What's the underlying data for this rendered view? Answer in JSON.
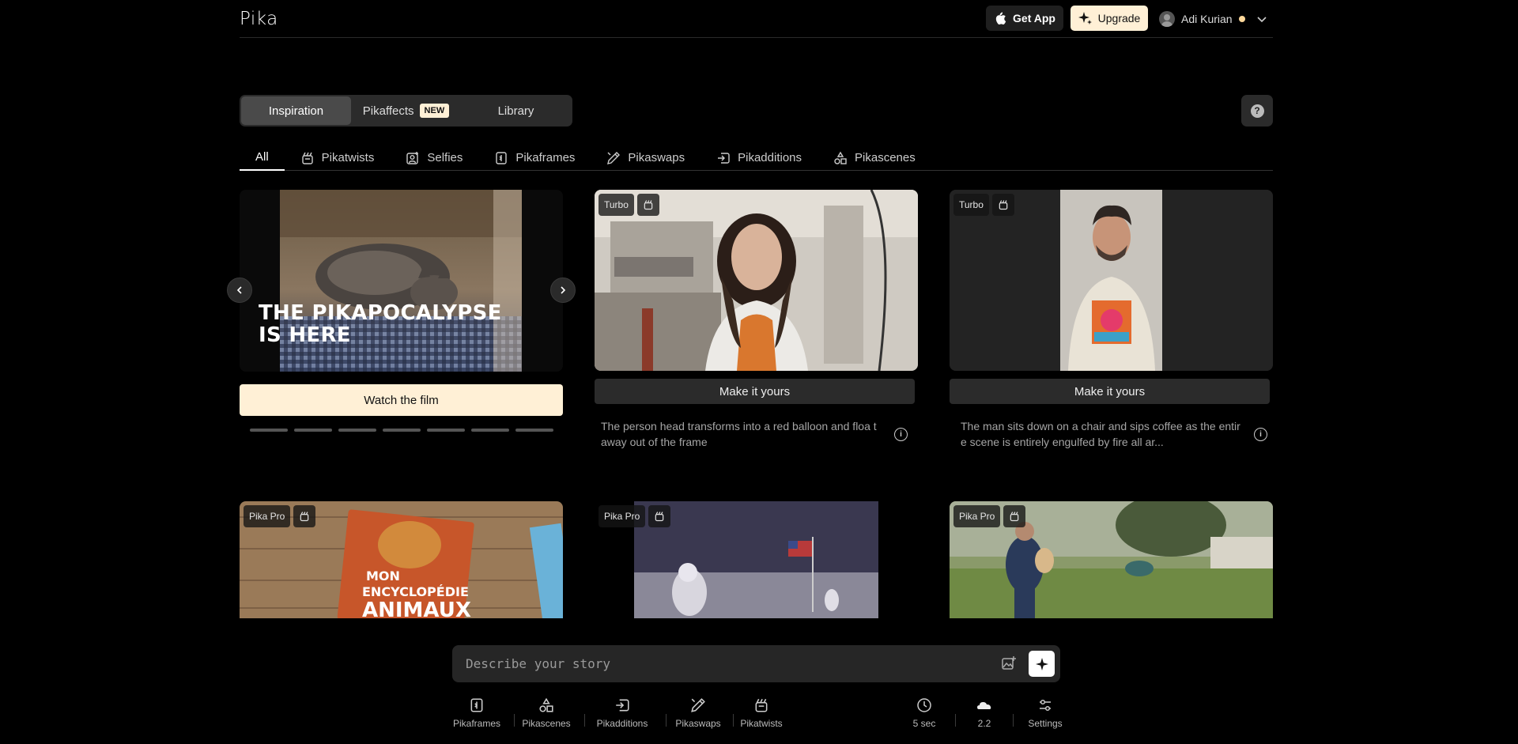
{
  "header": {
    "logo": "Pika",
    "get_app_label": "Get App",
    "upgrade_label": "Upgrade",
    "user_name": "Adi Kurian"
  },
  "top_tabs": [
    {
      "label": "Inspiration"
    },
    {
      "label": "Pikaffects",
      "badge": "NEW"
    },
    {
      "label": "Library"
    }
  ],
  "help_label": "?",
  "categories": [
    {
      "label": "All"
    },
    {
      "label": "Pikatwists"
    },
    {
      "label": "Selfies"
    },
    {
      "label": "Pikaframes"
    },
    {
      "label": "Pikaswaps"
    },
    {
      "label": "Pikadditions"
    },
    {
      "label": "Pikascenes"
    }
  ],
  "hero": {
    "headline_line1": "THE PIKAPOCALYPSE",
    "headline_line2": "IS HERE",
    "button_label": "Watch the film",
    "prev_icon": "chevron-left-icon",
    "next_icon": "chevron-right-icon"
  },
  "cards": [
    {
      "tag": "Turbo",
      "button_label": "Make it yours",
      "description": "The person head transforms into a red balloon and floa t away out of the frame"
    },
    {
      "tag": "Turbo",
      "button_label": "Make it yours",
      "description": "The man sits down on a chair and sips coffee as the entire scene is entirely engulfed by fire all ar..."
    }
  ],
  "row2_cards": [
    {
      "tag": "Pika Pro",
      "book_line1": "MON",
      "book_line2": "ENCYCLOPÉDIE",
      "book_line3": "ANIMAUX"
    },
    {
      "tag": "Pika Pro"
    },
    {
      "tag": "Pika Pro"
    }
  ],
  "composer": {
    "placeholder": "Describe your story"
  },
  "tools_left": [
    {
      "label": "Pikaframes",
      "icon": "pikaframes-icon"
    },
    {
      "label": "Pikascenes",
      "icon": "pikascenes-icon"
    },
    {
      "label": "Pikadditions",
      "icon": "pikadditions-icon"
    },
    {
      "label": "Pikaswaps",
      "icon": "pikaswaps-icon"
    },
    {
      "label": "Pikatwists",
      "icon": "pikatwists-icon"
    }
  ],
  "tools_right": [
    {
      "label": "5 sec",
      "icon": "clock-icon"
    },
    {
      "label": "2.2",
      "icon": "cloud-icon"
    },
    {
      "label": "Settings",
      "icon": "settings-sliders-icon"
    }
  ]
}
